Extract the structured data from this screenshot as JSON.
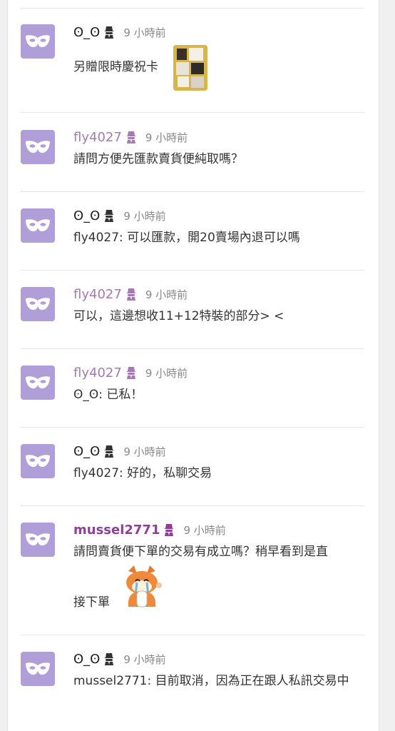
{
  "comments": [
    {
      "author": "ʘ_ʘ",
      "time": "9 小時前",
      "text": "另贈限時慶祝卡"
    },
    {
      "author": "fly4027",
      "time": "9 小時前",
      "text": "請問方便先匯款賣貨便純取嗎？"
    },
    {
      "author": "ʘ_ʘ",
      "time": "9 小時前",
      "text": "fly4027: 可以匯款，開20賣場內退可以嗎"
    },
    {
      "author": "fly4027",
      "time": "9 小時前",
      "text": "可以，這邊想收11+12特裝的部分> <"
    },
    {
      "author": "fly4027",
      "time": "9 小時前",
      "text": "ʘ_ʘ: 已私！"
    },
    {
      "author": "ʘ_ʘ",
      "time": "9 小時前",
      "text": "fly4027: 好的，私聊交易"
    },
    {
      "author": "mussel2771",
      "time": "9 小時前",
      "text_line1": "請問賣貨便下單的交易有成立嗎？稍早看到是直",
      "text_line2": "接下單"
    },
    {
      "author": "ʘ_ʘ",
      "time": "9 小時前",
      "text": "mussel2771: 目前取消，因為正在跟人私訊交易中"
    }
  ],
  "icons": {
    "avatar": "mask-icon",
    "badge": "spy-icon",
    "image": "photo-thumbnail",
    "sticker": "crying-fox-sticker"
  },
  "colors": {
    "avatar_bg": "#b09ed8",
    "name_purple": "#a47ab0",
    "name_strong": "#8f3f9a",
    "time": "#888888",
    "divider": "#e6e6e6"
  }
}
